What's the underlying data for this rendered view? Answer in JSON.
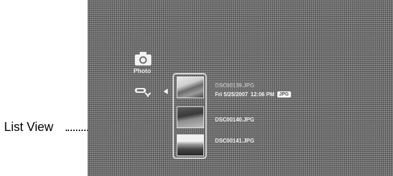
{
  "callout": {
    "label": "List View"
  },
  "category": {
    "label": "Photo",
    "icon": "camera-icon"
  },
  "sort": {
    "icon": "sort-icon"
  },
  "items": [
    {
      "name": "DSC00139.JPG",
      "date": "Fri 5/25/2007",
      "time": "12:06 PM",
      "badge": "JPG"
    },
    {
      "name": "DSC00140.JPG"
    },
    {
      "name": "DSC00141.JPG"
    }
  ],
  "colors": {
    "screen": "#6e6e6e",
    "text": "#f4f4f4"
  }
}
